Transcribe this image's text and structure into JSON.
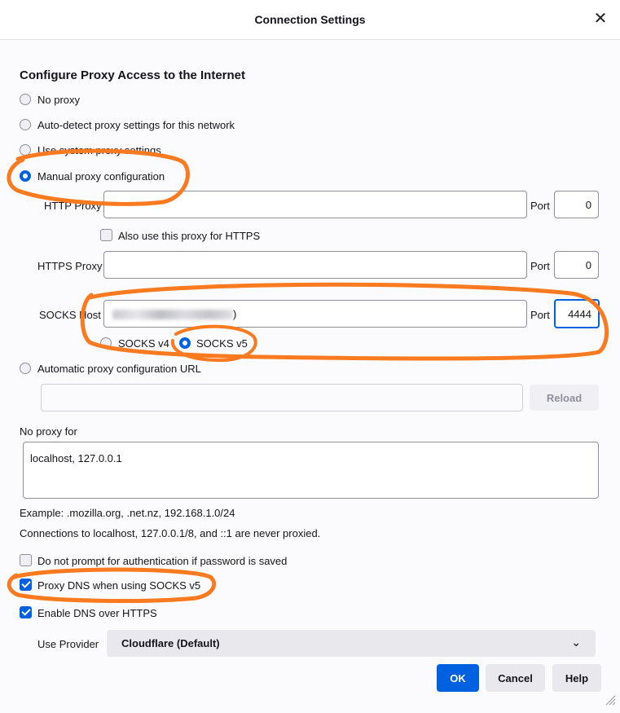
{
  "window": {
    "title": "Connection Settings",
    "close_glyph": "✕"
  },
  "section": {
    "heading": "Configure Proxy Access to the Internet"
  },
  "proxy_modes": {
    "no_proxy": "No proxy",
    "auto_detect": "Auto-detect proxy settings for this network",
    "system": "Use system proxy settings",
    "manual": "Manual proxy configuration",
    "auto_url": "Automatic proxy configuration URL",
    "selected": "manual"
  },
  "http": {
    "label": "HTTP Proxy",
    "value": "",
    "port_label": "Port",
    "port": "0"
  },
  "also_https": {
    "label": "Also use this proxy for HTTPS",
    "checked": false
  },
  "https": {
    "label": "HTTPS Proxy",
    "value": "",
    "port_label": "Port",
    "port": "0"
  },
  "socks": {
    "label": "SOCKS Host",
    "value_suffix": ")",
    "port_label": "Port",
    "port": "4444",
    "v4_label": "SOCKS v4",
    "v5_label": "SOCKS v5",
    "version_selected": "v5"
  },
  "auto_url": {
    "value": "",
    "reload_label": "Reload"
  },
  "no_proxy_for": {
    "label": "No proxy for",
    "value": "localhost, 127.0.0.1"
  },
  "notes": {
    "example": "Example: .mozilla.org, .net.nz, 192.168.1.0/24",
    "localhost": "Connections to localhost, 127.0.0.1/8, and ::1 are never proxied."
  },
  "options": {
    "no_prompt": {
      "label": "Do not prompt for authentication if password is saved",
      "checked": false
    },
    "proxy_dns": {
      "label": "Proxy DNS when using SOCKS v5",
      "checked": true
    },
    "doh": {
      "label": "Enable DNS over HTTPS",
      "checked": true
    }
  },
  "provider": {
    "label": "Use Provider",
    "value": "Cloudflare (Default)"
  },
  "buttons": {
    "ok": "OK",
    "cancel": "Cancel",
    "help": "Help"
  },
  "colors": {
    "accent": "#0061e0",
    "annotation": "#f97a1f"
  }
}
